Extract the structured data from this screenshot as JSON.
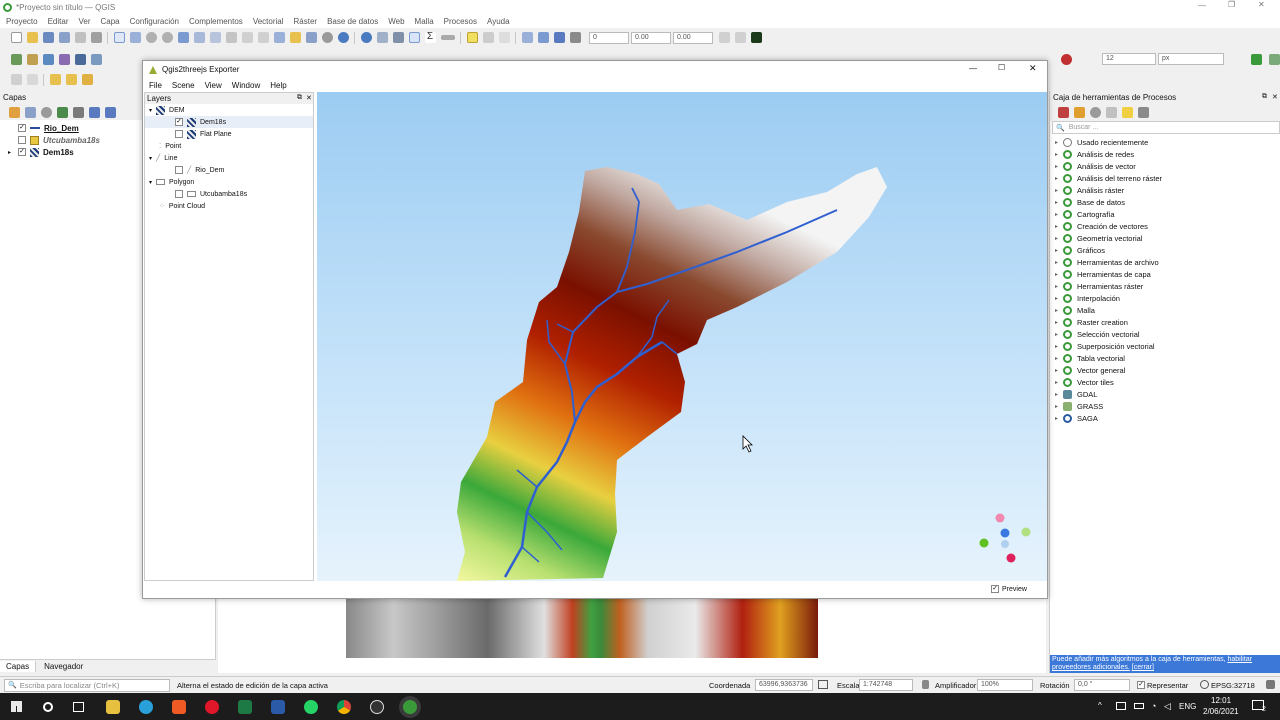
{
  "qgis": {
    "title": "*Proyecto sin título — QGIS",
    "menu": [
      "Proyecto",
      "Editar",
      "Ver",
      "Capa",
      "Configuración",
      "Complementos",
      "Vectorial",
      "Ráster",
      "Base de datos",
      "Web",
      "Malla",
      "Procesos",
      "Ayuda"
    ],
    "toolbar_values": {
      "v1": "0",
      "v2": "0.00",
      "v3": "0.00",
      "font_size": "12",
      "unit": "px"
    }
  },
  "layers_panel": {
    "title": "Capas",
    "layers": [
      {
        "name": "Rio_Dem",
        "checked": true
      },
      {
        "name": "Utcubamba18s",
        "checked": false
      },
      {
        "name": "Dem18s",
        "checked": true
      }
    ],
    "tabs": [
      "Capas",
      "Navegador"
    ]
  },
  "exporter": {
    "title": "Qgis2threejs Exporter",
    "menu": [
      "File",
      "Scene",
      "View",
      "Window",
      "Help"
    ],
    "layers_title": "Layers",
    "tree": {
      "dem": "DEM",
      "dem_items": [
        "Dem18s",
        "Flat Plane"
      ],
      "point": "Point",
      "line": "Line",
      "line_items": [
        "Rio_Dem"
      ],
      "polygon": "Polygon",
      "polygon_items": [
        "Utcubamba18s"
      ],
      "cloud": "Point Cloud"
    },
    "preview_label": "Preview",
    "preview_checked": true
  },
  "processing": {
    "title": "Caja de herramientas de Procesos",
    "search_placeholder": "Buscar ...",
    "items": [
      "Usado recientemente",
      "Análisis de redes",
      "Análisis de vector",
      "Análisis del terreno ráster",
      "Análisis ráster",
      "Base de datos",
      "Cartografía",
      "Creación de vectores",
      "Geometría vectorial",
      "Gráficos",
      "Herramientas de archivo",
      "Herramientas de capa",
      "Herramientas ráster",
      "Interpolación",
      "Malla",
      "Raster creation",
      "Selección vectorial",
      "Superposición vectorial",
      "Tabla vectorial",
      "Vector general",
      "Vector tiles",
      "GDAL",
      "GRASS",
      "SAGA"
    ],
    "notice": "Puede añadir más algoritmos a la caja de herramientas,",
    "notice_link1": "habilitar proveedores adicionales.",
    "notice_link2": "[cerrar]"
  },
  "status": {
    "locate_placeholder": "Escriba para localizar (Ctrl+K)",
    "message": "Alterna el estado de edición de la capa activa",
    "coord_label": "Coordenada",
    "coord_value": "63996,9363736",
    "scale_label": "Escala",
    "scale_value": "1:742748",
    "magnifier_label": "Amplificador",
    "magnifier_value": "100%",
    "rotation_label": "Rotación",
    "rotation_value": "0,0 °",
    "render_label": "Representar",
    "crs": "EPSG:32718"
  },
  "taskbar": {
    "lang": "ENG",
    "time": "12:01",
    "date": "2/06/2021",
    "notif": "2"
  },
  "colors": {
    "accent": "#3c78d8",
    "river": "#2f5fd0",
    "qgis_green": "#3a9a3a"
  }
}
